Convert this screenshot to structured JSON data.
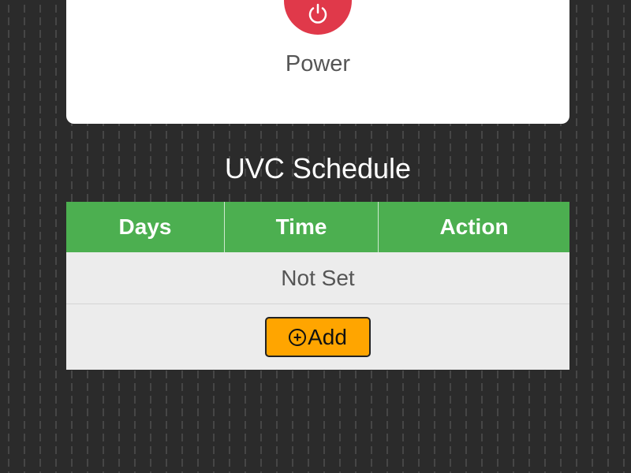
{
  "power": {
    "label": "Power",
    "icon": "power-icon",
    "color": "#e0394a"
  },
  "schedule": {
    "title": "UVC Schedule",
    "columns": [
      "Days",
      "Time",
      "Action"
    ],
    "empty_text": "Not Set",
    "add_label": "Add",
    "add_icon": "plus-circle-icon",
    "header_color": "#4caf50",
    "add_color": "#ffa500"
  }
}
